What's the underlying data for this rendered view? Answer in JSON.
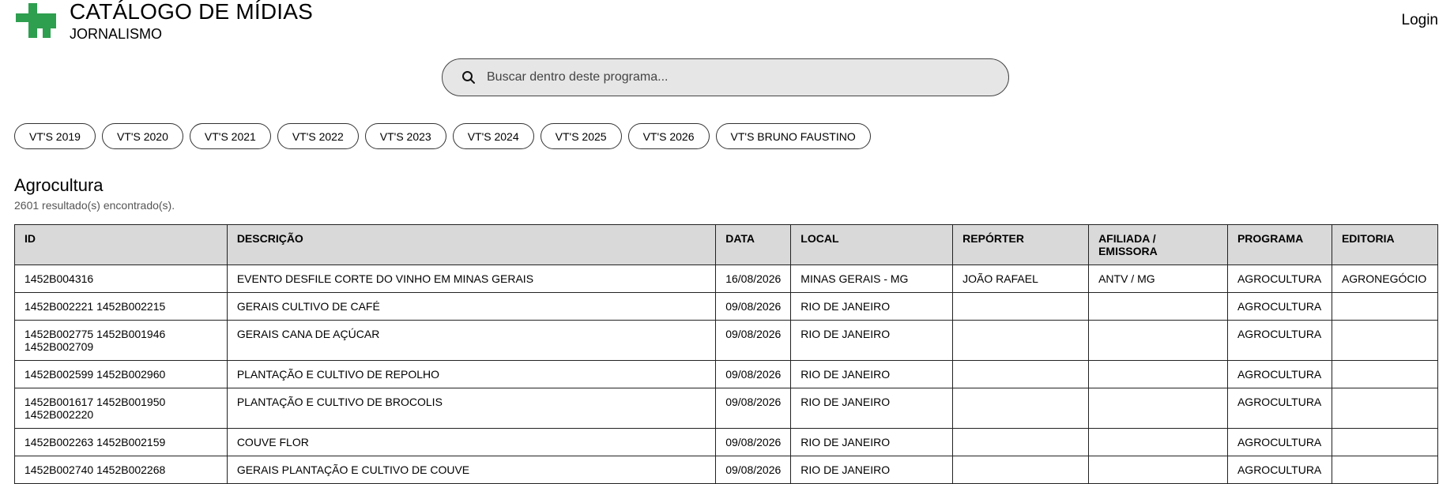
{
  "header": {
    "title": "CATÁLOGO DE MÍDIAS",
    "subtitle": "JORNALISMO",
    "login_label": "Login",
    "logo_color": "#2e9e4f"
  },
  "search": {
    "placeholder": "Buscar dentro deste programa...",
    "value": ""
  },
  "chips": [
    "VT'S 2019",
    "VT'S 2020",
    "VT'S 2021",
    "VT'S 2022",
    "VT'S 2023",
    "VT'S 2024",
    "VT'S 2025",
    "VT'S 2026",
    "VT'S BRUNO FAUSTINO"
  ],
  "section": {
    "title": "Agrocultura",
    "count_text": "2601 resultado(s) encontrado(s)."
  },
  "table": {
    "columns": [
      "ID",
      "DESCRIÇÃO",
      "DATA",
      "LOCAL",
      "REPÓRTER",
      "AFILIADA / EMISSORA",
      "PROGRAMA",
      "EDITORIA"
    ],
    "rows": [
      [
        "1452B004316",
        "EVENTO DESFILE CORTE DO VINHO EM MINAS GERAIS",
        "16/08/2026",
        "MINAS GERAIS - MG",
        "JOÃO RAFAEL",
        "ANTV / MG",
        "AGROCULTURA",
        "AGRONEGÓCIO"
      ],
      [
        "1452B002221 1452B002215",
        "GERAIS CULTIVO DE CAFÉ",
        "09/08/2026",
        "RIO DE JANEIRO",
        "",
        "",
        "AGROCULTURA",
        ""
      ],
      [
        "1452B002775 1452B001946 1452B002709",
        "GERAIS CANA DE AÇÚCAR",
        "09/08/2026",
        "RIO DE JANEIRO",
        "",
        "",
        "AGROCULTURA",
        ""
      ],
      [
        "1452B002599 1452B002960",
        "PLANTAÇÃO E CULTIVO DE REPOLHO",
        "09/08/2026",
        "RIO DE JANEIRO",
        "",
        "",
        "AGROCULTURA",
        ""
      ],
      [
        "1452B001617 1452B001950 1452B002220",
        "PLANTAÇÃO E CULTIVO DE BROCOLIS",
        "09/08/2026",
        "RIO DE JANEIRO",
        "",
        "",
        "AGROCULTURA",
        ""
      ],
      [
        "1452B002263 1452B002159",
        "COUVE FLOR",
        "09/08/2026",
        "RIO DE JANEIRO",
        "",
        "",
        "AGROCULTURA",
        ""
      ],
      [
        "1452B002740 1452B002268",
        "GERAIS PLANTAÇÃO E CULTIVO DE COUVE",
        "09/08/2026",
        "RIO DE JANEIRO",
        "",
        "",
        "AGROCULTURA",
        ""
      ]
    ]
  }
}
